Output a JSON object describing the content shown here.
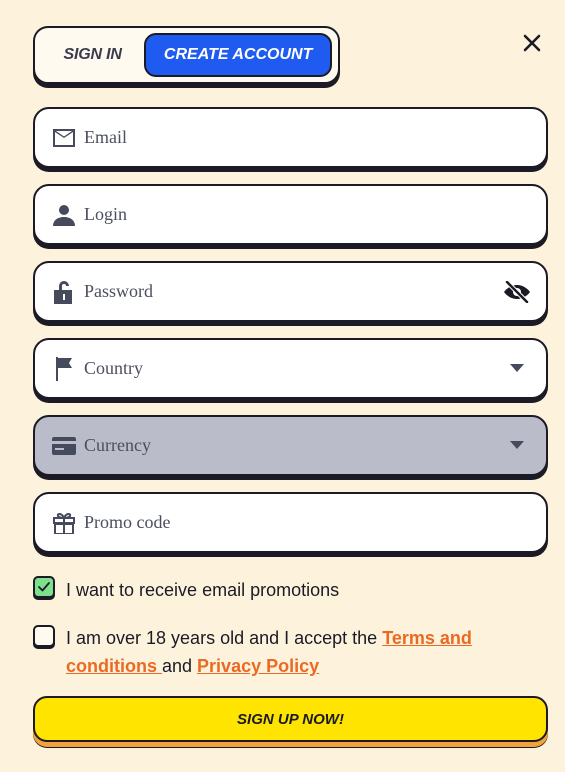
{
  "tabs": {
    "signin": "SIGN IN",
    "create": "CREATE ACCOUNT"
  },
  "fields": {
    "email": {
      "placeholder": "Email",
      "icon": "envelope-icon"
    },
    "login": {
      "placeholder": "Login",
      "icon": "user-icon"
    },
    "password": {
      "placeholder": "Password",
      "icon": "lock-icon",
      "toggle_icon": "eye-off-icon"
    },
    "country": {
      "placeholder": "Country",
      "icon": "flag-icon"
    },
    "currency": {
      "placeholder": "Currency",
      "icon": "card-icon",
      "disabled": true
    },
    "promo": {
      "placeholder": "Promo code",
      "icon": "gift-icon"
    }
  },
  "consent": {
    "promotions": {
      "checked": true,
      "label": "I want to receive email promotions"
    },
    "terms": {
      "checked": false,
      "text_before": "I am over 18 years old and I accept the ",
      "terms_link": "Terms and conditions ",
      "text_mid": "and ",
      "privacy_link": "Privacy Policy"
    }
  },
  "submit_label": "SIGN UP NOW!",
  "colors": {
    "background": "#fdf3dc",
    "accent_blue": "#1f5bf0",
    "cta_yellow": "#ffe400",
    "link_orange": "#ea6a24",
    "check_green": "#7ee08a"
  }
}
